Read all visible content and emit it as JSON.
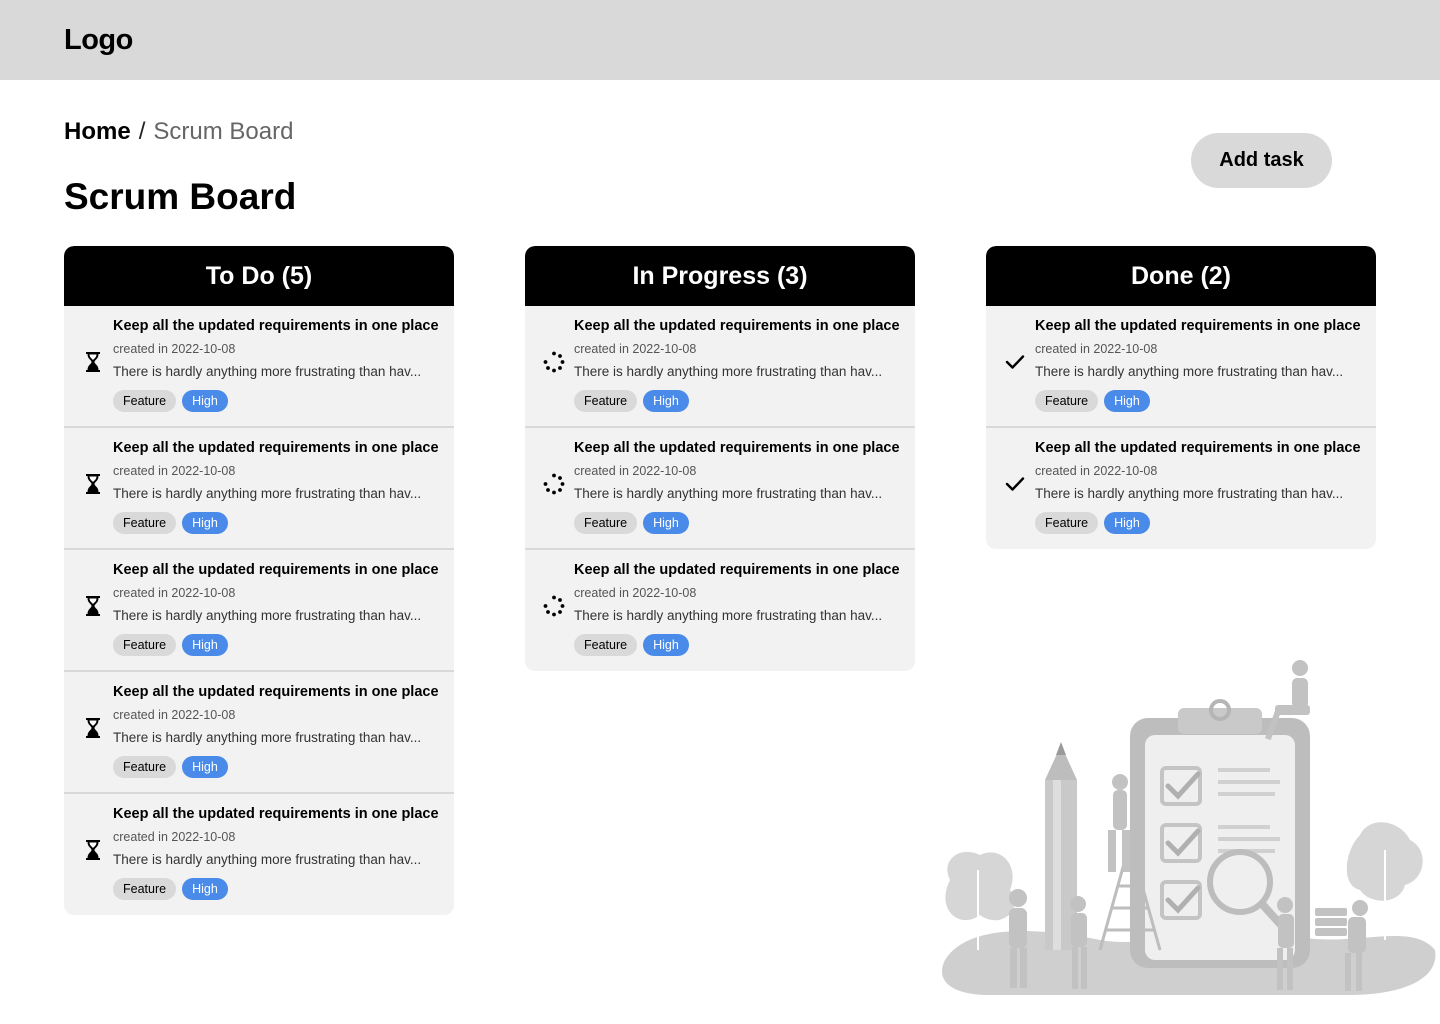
{
  "header": {
    "logo": "Logo"
  },
  "breadcrumb": {
    "home": "Home",
    "separator": "/",
    "current": "Scrum Board"
  },
  "page_title": "Scrum Board",
  "add_task_label": "Add task",
  "colors": {
    "accent_priority": "#4a8ae8",
    "header_bg": "#000000",
    "topbar_bg": "#d9d9d9",
    "card_bg": "#f2f2f2"
  },
  "columns": [
    {
      "title": "To Do (5)",
      "status_icon": "hourglass-icon",
      "cards": [
        {
          "title": "Keep all the updated requirements in one place",
          "date": "created in 2022-10-08",
          "desc": "There is hardly anything more frustrating than hav...",
          "type": "Feature",
          "priority": "High"
        },
        {
          "title": "Keep all the updated requirements in one place",
          "date": "created in 2022-10-08",
          "desc": "There is hardly anything more frustrating than hav...",
          "type": "Feature",
          "priority": "High"
        },
        {
          "title": "Keep all the updated requirements in one place",
          "date": "created in 2022-10-08",
          "desc": "There is hardly anything more frustrating than hav...",
          "type": "Feature",
          "priority": "High"
        },
        {
          "title": "Keep all the updated requirements in one place",
          "date": "created in 2022-10-08",
          "desc": "There is hardly anything more frustrating than hav...",
          "type": "Feature",
          "priority": "High"
        },
        {
          "title": "Keep all the updated requirements in one place",
          "date": "created in 2022-10-08",
          "desc": "There is hardly anything more frustrating than hav...",
          "type": "Feature",
          "priority": "High"
        }
      ]
    },
    {
      "title": "In Progress (3)",
      "status_icon": "spinner-icon",
      "cards": [
        {
          "title": "Keep all the updated requirements in one place",
          "date": "created in 2022-10-08",
          "desc": "There is hardly anything more frustrating than hav...",
          "type": "Feature",
          "priority": "High"
        },
        {
          "title": "Keep all the updated requirements in one place",
          "date": "created in 2022-10-08",
          "desc": "There is hardly anything more frustrating than hav...",
          "type": "Feature",
          "priority": "High"
        },
        {
          "title": "Keep all the updated requirements in one place",
          "date": "created in 2022-10-08",
          "desc": "There is hardly anything more frustrating than hav...",
          "type": "Feature",
          "priority": "High"
        }
      ]
    },
    {
      "title": "Done (2)",
      "status_icon": "check-icon",
      "cards": [
        {
          "title": "Keep all the updated requirements in one place",
          "date": "created in 2022-10-08",
          "desc": "There is hardly anything more frustrating than hav...",
          "type": "Feature",
          "priority": "High"
        },
        {
          "title": "Keep all the updated requirements in one place",
          "date": "created in 2022-10-08",
          "desc": "There is hardly anything more frustrating than hav...",
          "type": "Feature",
          "priority": "High"
        }
      ]
    }
  ]
}
